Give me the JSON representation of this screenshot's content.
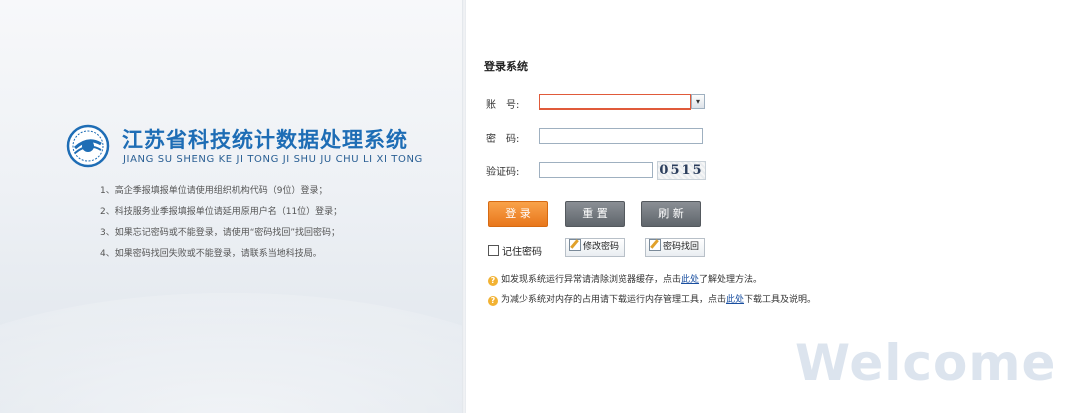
{
  "brand": {
    "title": "江苏省科技统计数据处理系统",
    "pinyin": "JIANG SU SHENG KE JI TONG JI SHU JU CHU LI XI TONG"
  },
  "notes": [
    "1、高企季报填报单位请使用组织机构代码（9位）登录；",
    "2、科技服务业季报填报单位请延用原用户名（11位）登录；",
    "3、如果忘记密码或不能登录，请使用“密码找回”找回密码；",
    "4、如果密码找回失败或不能登录，请联系当地科技局。"
  ],
  "login": {
    "title": "登录系统",
    "account_label": "账　号:",
    "account_value": "",
    "password_label": "密　码:",
    "password_value": "",
    "captcha_label": "验证码:",
    "captcha_value": "",
    "captcha_image_text": "0515"
  },
  "buttons": {
    "login": "登 录",
    "reset": "重 置",
    "refresh": "刷 新"
  },
  "options": {
    "remember": "记住密码",
    "change_password": "修改密码",
    "find_password": "密码找回"
  },
  "tips": [
    {
      "before": "如发现系统运行异常请清除浏览器缓存，点击",
      "link": "此处",
      "after": "了解处理方法。"
    },
    {
      "before": "为减少系统对内存的占用请下载运行内存管理工具，点击",
      "link": "此处",
      "after": "下载工具及说明。"
    }
  ],
  "welcome": "Welcome",
  "colors": {
    "title_blue": "#1e6db5",
    "login_orange": "#ef8a2e",
    "gray_button": "#6f757b"
  }
}
